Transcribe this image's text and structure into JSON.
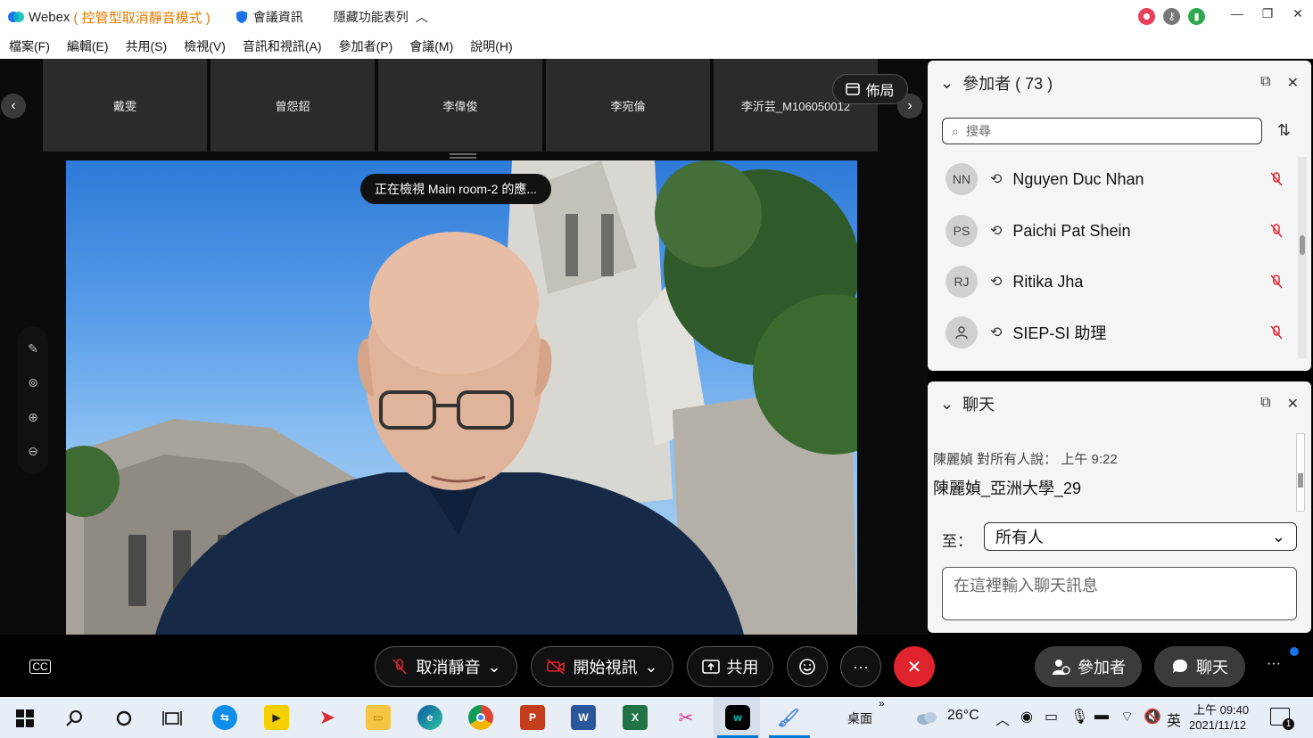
{
  "titlebar": {
    "app_name": "Webex",
    "mode": "( 控管型取消靜音模式 )",
    "meeting_info": "會議資訊",
    "hide_menu": "隱藏功能表列"
  },
  "window_controls": {
    "minimize": "—",
    "restore": "❐",
    "close": "✕"
  },
  "menu": [
    "檔案(F)",
    "編輯(E)",
    "共用(S)",
    "檢視(V)",
    "音訊和視訊(A)",
    "參加者(P)",
    "會議(M)",
    "說明(H)"
  ],
  "thumbnails": [
    "戴雯",
    "曾怨鉊",
    "李偉俊",
    "李宛倫",
    "李沂芸_M106050012"
  ],
  "layout_label": "佈局",
  "viewing_notice": "正在檢視 Main room-2 的應...",
  "participants_panel": {
    "title": "參加者 ( 73 )",
    "search_placeholder": "搜尋",
    "rows": [
      {
        "initials": "NN",
        "name": "Nguyen Duc Nhan"
      },
      {
        "initials": "PS",
        "name": "Paichi Pat Shein"
      },
      {
        "initials": "RJ",
        "name": "Ritika Jha"
      },
      {
        "initials": "",
        "name": "SIEP-SI 助理"
      }
    ]
  },
  "chat_panel": {
    "title": "聊天",
    "meta": "陳麗媜 對所有人說：   上午 9:22",
    "message": "陳麗媜_亞洲大學_29",
    "to_label": "至：",
    "to_value": "所有人",
    "input_placeholder": "在這裡輸入聊天訊息"
  },
  "controls": {
    "mute": "取消靜音",
    "video": "開始視訊",
    "share": "共用",
    "more": "···",
    "participants": "參加者",
    "chat": "聊天",
    "overflow": "···"
  },
  "taskbar": {
    "desktop_label": "桌面",
    "weather": "26°C",
    "ime": "英",
    "time": "上午 09:40",
    "date": "2021/11/12",
    "notif_count": "1"
  },
  "colors": {
    "end_red": "#e0242e",
    "mode_orange": "#e07a00",
    "panel_bg": "#f5f5f5"
  }
}
